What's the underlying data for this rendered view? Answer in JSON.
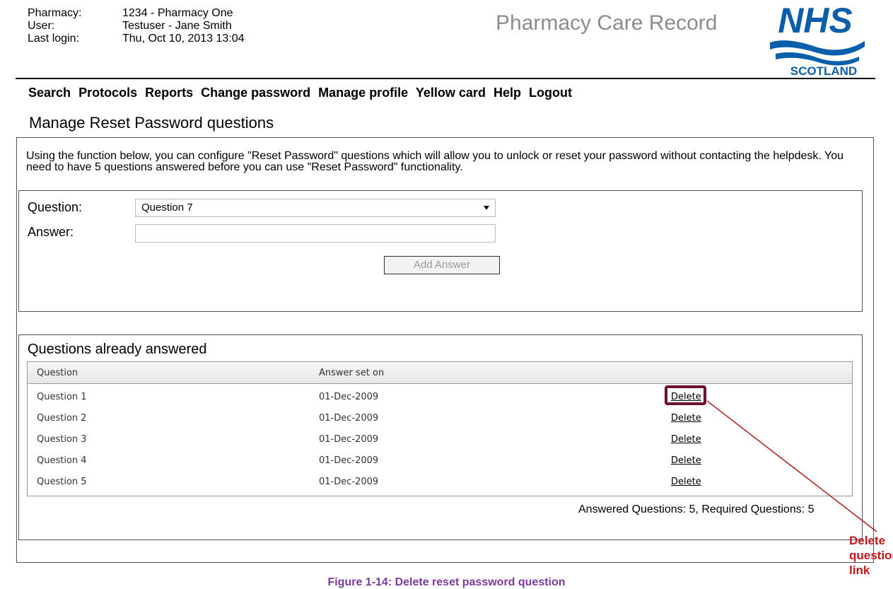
{
  "header": {
    "labels": [
      "Pharmacy:",
      "User:",
      "Last login:"
    ],
    "values": [
      "1234 - Pharmacy One",
      "Testuser - Jane Smith",
      "Thu, Oct 10, 2013 13:04"
    ],
    "app_title": "Pharmacy Care Record",
    "logo": {
      "top": "NHS",
      "bottom": "SCOTLAND",
      "color": "#0a5eab"
    }
  },
  "nav": [
    "Search",
    "Protocols",
    "Reports",
    "Change password",
    "Manage profile",
    "Yellow card",
    "Help",
    "Logout"
  ],
  "page_title": "Manage Reset Password questions",
  "intro": "Using the function below, you can configure \"Reset Password\" questions which will allow you to unlock or reset your password without contacting the helpdesk.  You need to have 5 questions answered before you can use \"Reset Password\" functionality.",
  "form": {
    "question_label": "Question:",
    "question_value": "Question 7",
    "answer_label": "Answer:",
    "answer_value": "",
    "add_button": "Add Answer"
  },
  "answered": {
    "title": "Questions already answered",
    "columns": [
      "Question",
      "Answer set on",
      ""
    ],
    "rows": [
      {
        "question": "Question 1",
        "date": "01-Dec-2009",
        "action": "Delete"
      },
      {
        "question": "Question 2",
        "date": "01-Dec-2009",
        "action": "Delete"
      },
      {
        "question": "Question 3",
        "date": "01-Dec-2009",
        "action": "Delete"
      },
      {
        "question": "Question 4",
        "date": "01-Dec-2009",
        "action": "Delete"
      },
      {
        "question": "Question 5",
        "date": "01-Dec-2009",
        "action": "Delete"
      }
    ],
    "summary": "Answered Questions: 5, Required Questions: 5"
  },
  "annotation": {
    "callout": "Delete question link",
    "color": "#c0181b",
    "highlight_color": "#6b1030"
  },
  "caption": "Figure 1-14: Delete reset password question"
}
